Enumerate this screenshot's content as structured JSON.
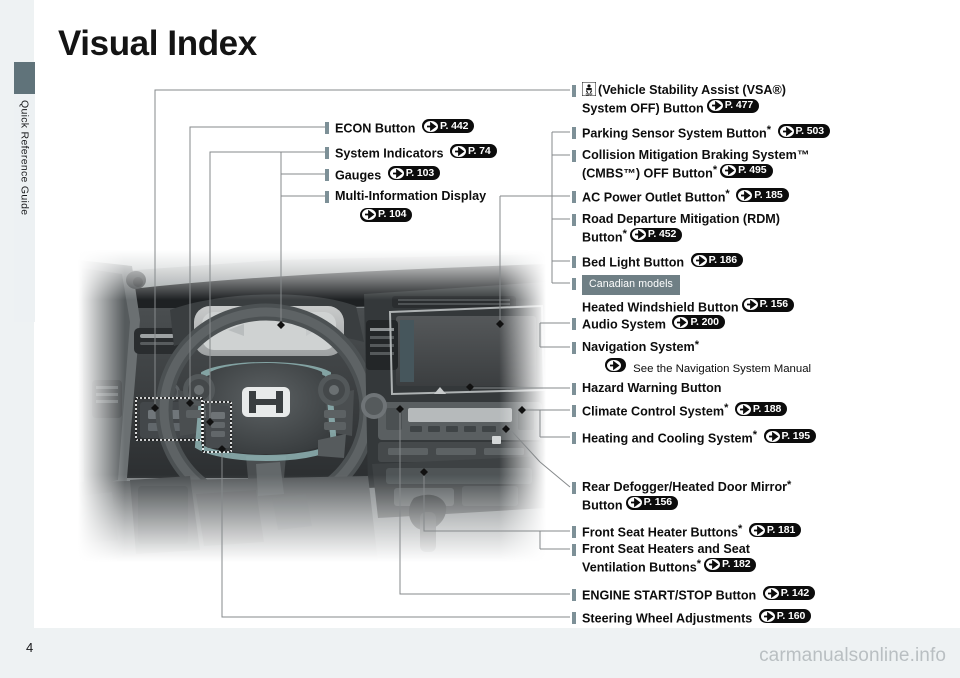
{
  "page": {
    "title": "Visual Index",
    "number": "4",
    "watermark": "carmanualsonline.info",
    "sidebar_label": "Quick Reference Guide",
    "sidebar_tab_color": "#60737a",
    "tick_color": "#7d9097",
    "badge_color": "#6f7f85",
    "pill_color": "#0c0c0c"
  },
  "left_callouts": [
    {
      "text": "ECON Button",
      "pref": "P. 442"
    },
    {
      "text": "System Indicators",
      "pref": "P. 74"
    },
    {
      "text": "Gauges",
      "pref": "P. 103"
    },
    {
      "text": "Multi-Information Display",
      "line2": "",
      "pref": "P. 104"
    }
  ],
  "left_callout_lines": {
    "multi_info_pref": "P. 104"
  },
  "right_callouts": [
    {
      "icon": "vsa-off-icon",
      "line1": "(Vehicle Stability Assist (VSA®)",
      "line2": "System OFF) Button",
      "pref": "P. 477"
    },
    {
      "line1": "Parking Sensor System Button",
      "star": "*",
      "pref": "P. 503"
    },
    {
      "line1": "Collision Mitigation Braking System™",
      "line2": "(CMBS™) OFF Button",
      "star": "*",
      "pref": "P. 495"
    },
    {
      "line1": "AC Power Outlet Button",
      "star": "*",
      "pref": "P. 185"
    },
    {
      "line1": "Road Departure Mitigation (RDM)",
      "line2": "Button",
      "star": "*",
      "pref": "P. 452"
    },
    {
      "line1": "Bed Light Button",
      "pref": "P. 186"
    },
    {
      "badge": "Canadian models",
      "line2": "Heated Windshield Button",
      "pref": "P. 156"
    },
    {
      "line1": "Audio System",
      "pref": "P. 200"
    },
    {
      "line1": "Navigation System",
      "star": "*",
      "note": "See the Navigation System Manual"
    },
    {
      "line1": "Hazard Warning Button"
    },
    {
      "line1": "Climate Control System",
      "star": "*",
      "pref": "P. 188"
    },
    {
      "line1": "Heating and Cooling System",
      "star": "*",
      "pref": "P. 195"
    },
    {
      "line1": "Rear Defogger/Heated Door Mirror",
      "star": "*",
      "line2": "Button",
      "pref": "P. 156"
    },
    {
      "line1": "Front Seat Heater Buttons",
      "star": "*",
      "pref": "P. 181"
    },
    {
      "line1": "Front Seat Heaters and Seat",
      "line2": "Ventilation Buttons",
      "star": "*",
      "pref": "P. 182"
    },
    {
      "line1": "ENGINE START/STOP Button",
      "pref": "P. 142"
    },
    {
      "line1": "Steering Wheel Adjustments",
      "pref": "P. 160"
    }
  ],
  "photo": {
    "description": "Honda dashboard interior grayscale photograph",
    "highlight_boxes": 2
  }
}
